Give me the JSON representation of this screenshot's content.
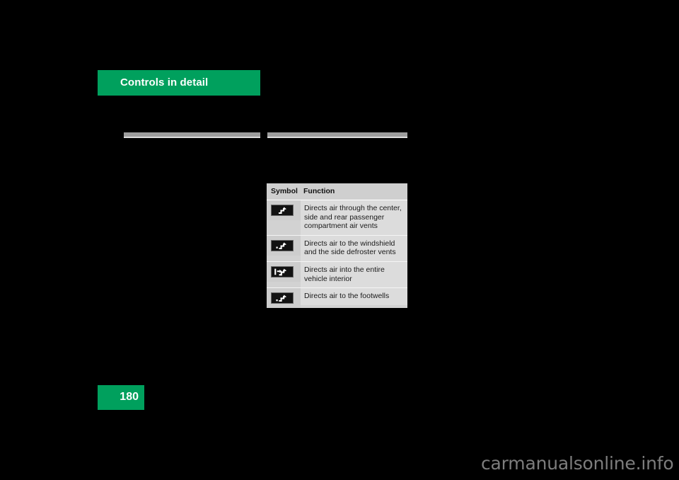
{
  "section": {
    "banner_title": "Controls in detail",
    "banner_color": "#00a05d"
  },
  "rules": {
    "left_rule_name": "left-column-rule",
    "right_rule_name": "right-column-rule",
    "rule_color": "#9d9d9d"
  },
  "table": {
    "headers": {
      "symbol": "Symbol",
      "function": "Function"
    },
    "rows": [
      {
        "symbol_name": "center-vents-airflow-icon",
        "function": "Directs air through the center, side and rear passenger compartment air vents"
      },
      {
        "symbol_name": "windshield-defroster-airflow-icon",
        "function": "Directs air to the windshield and the side defroster vents"
      },
      {
        "symbol_name": "entire-interior-airflow-icon",
        "function": "Directs air into the entire vehicle interior"
      },
      {
        "symbol_name": "footwell-airflow-icon",
        "function": "Directs air to the footwells"
      }
    ],
    "header_bg": "#cfcfcf",
    "symbol_cell_bg": "#cdcdcd",
    "text_cell_bg": "#dcdcdc"
  },
  "footer": {
    "page_number": "180",
    "watermark": "carmanualsonline.info"
  }
}
